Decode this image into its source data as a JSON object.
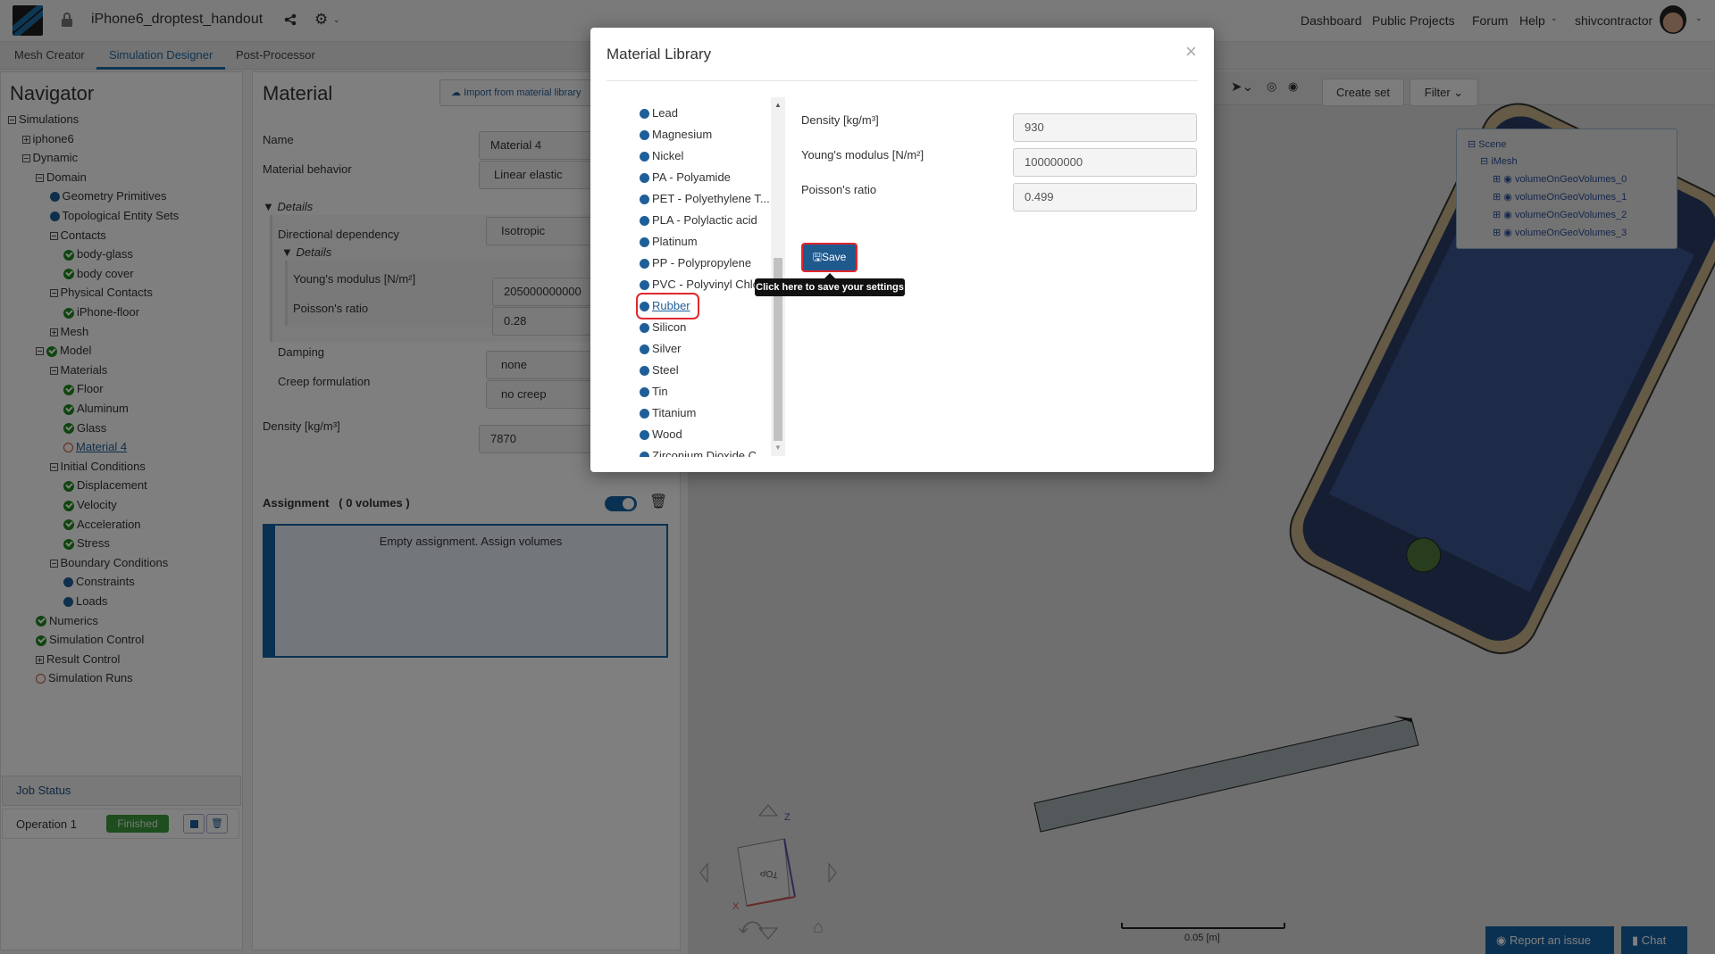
{
  "header": {
    "project_title": "iPhone6_droptest_handout",
    "nav": [
      "Dashboard",
      "Public Projects",
      "Forum",
      "Help"
    ],
    "username": "shivcontractor"
  },
  "tabs": [
    "Mesh Creator",
    "Simulation Designer",
    "Post-Processor"
  ],
  "navigator": {
    "title": "Navigator",
    "tree": [
      {
        "label": "Simulations",
        "level": 0,
        "icon": "minus"
      },
      {
        "label": "iphone6",
        "level": 1,
        "icon": "plus"
      },
      {
        "label": "Dynamic",
        "level": 1,
        "icon": "minus"
      },
      {
        "label": "Domain",
        "level": 2,
        "icon": "minus"
      },
      {
        "label": "Geometry Primitives",
        "level": 3,
        "icon": "dot"
      },
      {
        "label": "Topological Entity Sets",
        "level": 3,
        "icon": "dot"
      },
      {
        "label": "Contacts",
        "level": 3,
        "icon": "minus"
      },
      {
        "label": "body-glass",
        "level": 4,
        "icon": "check"
      },
      {
        "label": "body cover",
        "level": 4,
        "icon": "check"
      },
      {
        "label": "Physical Contacts",
        "level": 3,
        "icon": "minus"
      },
      {
        "label": "iPhone-floor",
        "level": 4,
        "icon": "check"
      },
      {
        "label": "Mesh",
        "level": 3,
        "icon": "plus"
      },
      {
        "label": "Model",
        "level": 2,
        "icon": "minus-check"
      },
      {
        "label": "Materials",
        "level": 3,
        "icon": "minus"
      },
      {
        "label": "Floor",
        "level": 4,
        "icon": "check"
      },
      {
        "label": "Aluminum",
        "level": 4,
        "icon": "check"
      },
      {
        "label": "Glass",
        "level": 4,
        "icon": "check"
      },
      {
        "label": "Material 4",
        "level": 4,
        "icon": "circle",
        "selected": true
      },
      {
        "label": "Initial Conditions",
        "level": 3,
        "icon": "minus"
      },
      {
        "label": "Displacement",
        "level": 4,
        "icon": "check"
      },
      {
        "label": "Velocity",
        "level": 4,
        "icon": "check"
      },
      {
        "label": "Acceleration",
        "level": 4,
        "icon": "check"
      },
      {
        "label": "Stress",
        "level": 4,
        "icon": "check"
      },
      {
        "label": "Boundary Conditions",
        "level": 3,
        "icon": "minus"
      },
      {
        "label": "Constraints",
        "level": 4,
        "icon": "dot"
      },
      {
        "label": "Loads",
        "level": 4,
        "icon": "dot"
      },
      {
        "label": "Numerics",
        "level": 2,
        "icon": "check"
      },
      {
        "label": "Simulation Control",
        "level": 2,
        "icon": "check"
      },
      {
        "label": "Result Control",
        "level": 2,
        "icon": "plus"
      },
      {
        "label": "Simulation Runs",
        "level": 2,
        "icon": "circle"
      }
    ]
  },
  "job_status": {
    "title": "Job Status",
    "operation": "Operation 1",
    "status": "Finished"
  },
  "material_panel": {
    "title": "Material",
    "import_button": "Import from material library",
    "name_label": "Name",
    "name_value": "Material 4",
    "behavior_label": "Material behavior",
    "behavior_value": "Linear elastic",
    "details": "Details",
    "directional_label": "Directional dependency",
    "directional_value": "Isotropic",
    "inner_details": "Details",
    "youngs_label": "Young's modulus [N/m²]",
    "youngs_value": "205000000000",
    "poisson_label": "Poisson's ratio",
    "poisson_value": "0.28",
    "damping_label": "Damping",
    "damping_value": "none",
    "creep_label": "Creep formulation",
    "creep_value": "no creep",
    "density_label": "Density [kg/m³]",
    "density_value": "7870",
    "assignment_label": "Assignment",
    "assignment_count": "( 0 volumes )",
    "assignment_empty": "Empty assignment. Assign volumes"
  },
  "viewer": {
    "create_set": "Create set",
    "filter": "Filter",
    "scene_tree": [
      "Scene",
      "iMesh",
      "volumeOnGeoVolumes_0",
      "volumeOnGeoVolumes_1",
      "volumeOnGeoVolumes_2",
      "volumeOnGeoVolumes_3"
    ],
    "scale_label": "0.05 [m]",
    "cube_face": "TOP",
    "axis_z": "Z",
    "axis_x": "X"
  },
  "footer": {
    "report": "Report an issue",
    "chat": "Chat"
  },
  "modal": {
    "title": "Material Library",
    "close": "×",
    "materials": [
      "Lead",
      "Magnesium",
      "Nickel",
      "PA - Polyamide",
      "PET - Polyethylene T...",
      "PLA - Polylactic acid",
      "Platinum",
      "PP - Polypropylene",
      "PVC - Polyvinyl Chlo...",
      "Rubber",
      "Silicon",
      "Silver",
      "Steel",
      "Tin",
      "Titanium",
      "Wood",
      "Zirconium Dioxide C..."
    ],
    "selected": "Rubber",
    "density_label": "Density [kg/m³]",
    "density_value": "930",
    "youngs_label": "Young's modulus [N/m²]",
    "youngs_value": "100000000",
    "poisson_label": "Poisson's ratio",
    "poisson_value": "0.499",
    "save": "Save",
    "tooltip": "Click here to save your settings"
  },
  "colors": {
    "accent": "#1f5f99",
    "selection_outline": "#e0282d",
    "success": "#2f7d32"
  }
}
